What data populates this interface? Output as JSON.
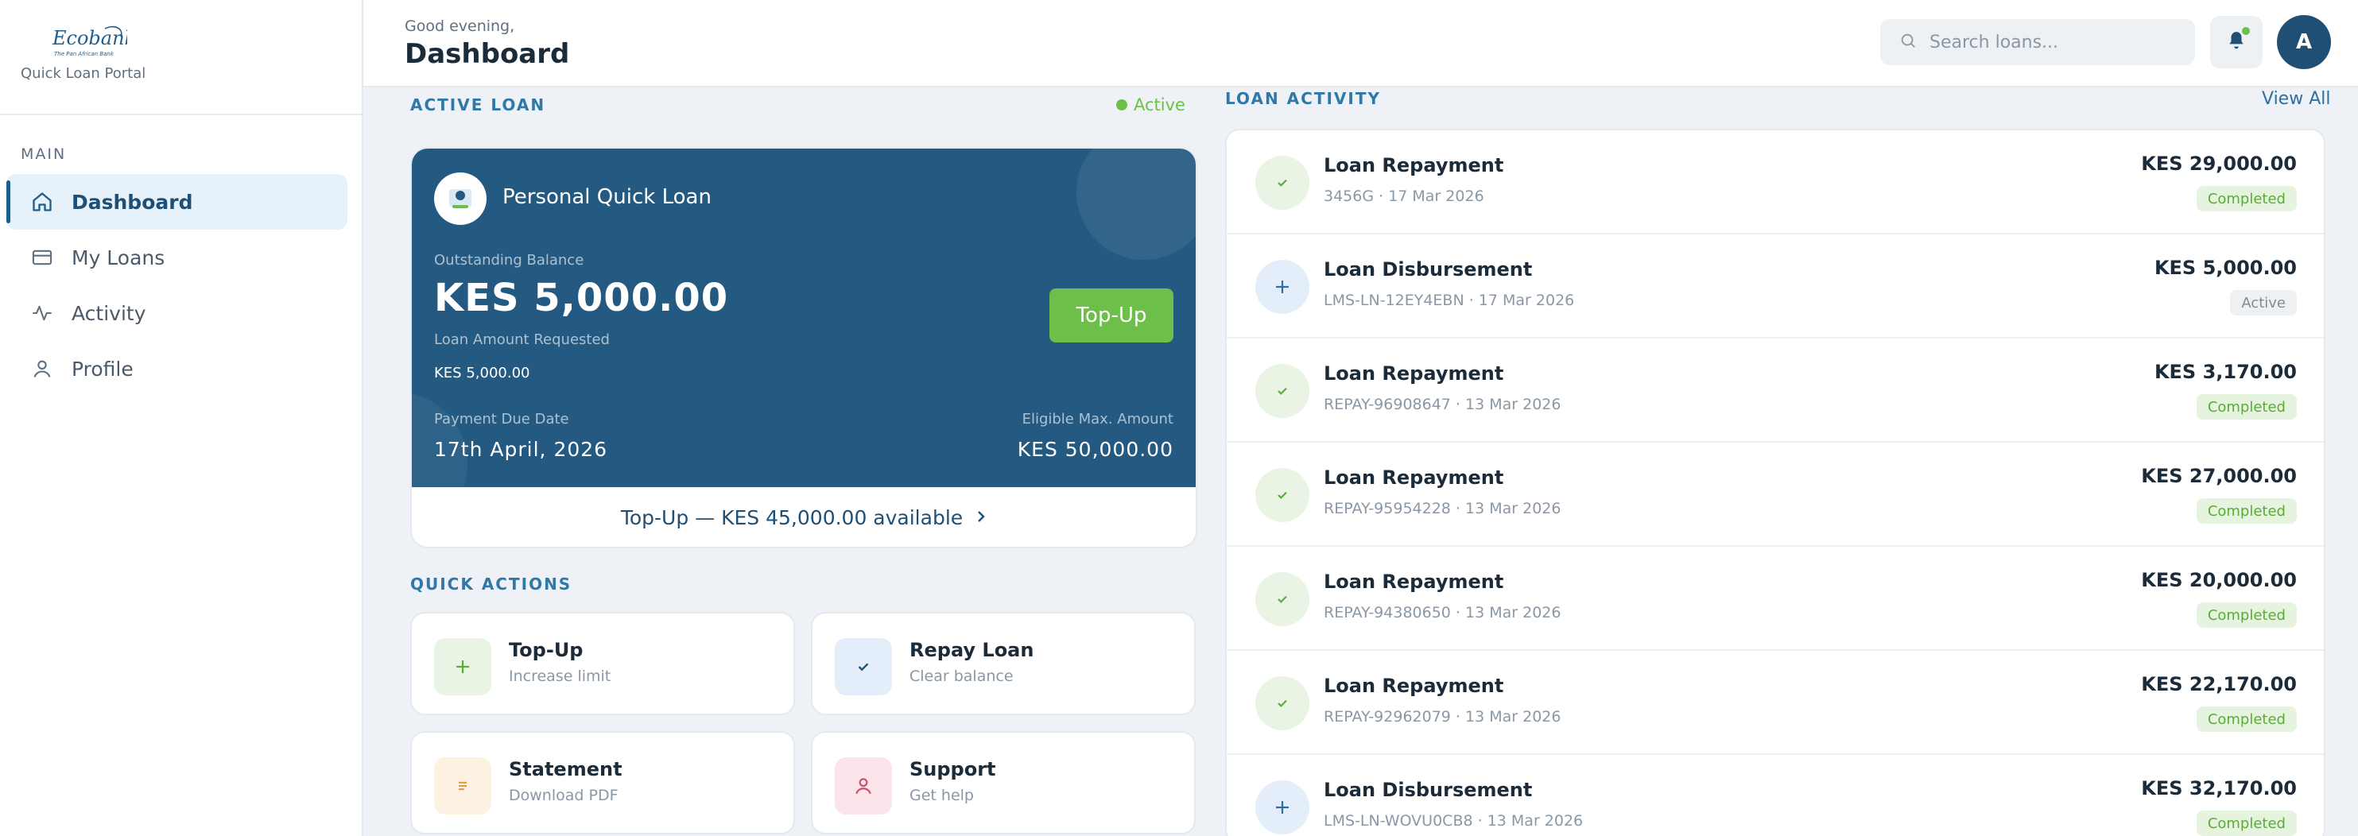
{
  "brand": {
    "logo_text": "Ecobank",
    "logo_tagline": "The Pan African Bank",
    "portal_name": "Quick Loan Portal"
  },
  "sidebar": {
    "section": "MAIN",
    "items": [
      {
        "label": "Dashboard",
        "icon": "home-icon",
        "active": true
      },
      {
        "label": "My Loans",
        "icon": "card-icon",
        "active": false
      },
      {
        "label": "Activity",
        "icon": "activity-icon",
        "active": false
      },
      {
        "label": "Profile",
        "icon": "user-icon",
        "active": false
      }
    ]
  },
  "header": {
    "greeting": "Good evening,",
    "title": "Dashboard",
    "search_placeholder": "Search loans...",
    "avatar_initial": "A"
  },
  "active_loan": {
    "section_label": "ACTIVE LOAN",
    "status": "Active",
    "name": "Personal Quick Loan",
    "outstanding_label": "Outstanding Balance",
    "outstanding_value": "KES 5,000.00",
    "requested_label": "Loan Amount Requested",
    "requested_value": "KES 5,000.00",
    "due_label": "Payment Due Date",
    "due_value": "17th April, 2026",
    "eligible_label": "Eligible Max. Amount",
    "eligible_value": "KES 50,000.00",
    "topup_button": "Top-Up",
    "topup_footer": "Top-Up — KES 45,000.00 available"
  },
  "quick_actions": {
    "section_label": "QUICK ACTIONS",
    "items": [
      {
        "title": "Top-Up",
        "subtitle": "Increase limit",
        "icon": "plus-icon"
      },
      {
        "title": "Repay Loan",
        "subtitle": "Clear balance",
        "icon": "check-icon"
      },
      {
        "title": "Statement",
        "subtitle": "Download PDF",
        "icon": "document-icon"
      },
      {
        "title": "Support",
        "subtitle": "Get help",
        "icon": "person-icon"
      }
    ]
  },
  "activity": {
    "section_label": "LOAN ACTIVITY",
    "view_all": "View All",
    "rows": [
      {
        "type": "repay",
        "title": "Loan Repayment",
        "subtitle": "3456G · 17 Mar 2026",
        "amount": "KES 29,000.00",
        "status": "Completed"
      },
      {
        "type": "disb",
        "title": "Loan Disbursement",
        "subtitle": "LMS-LN-12EY4EBN · 17 Mar 2026",
        "amount": "KES 5,000.00",
        "status": "Active"
      },
      {
        "type": "repay",
        "title": "Loan Repayment",
        "subtitle": "REPAY-96908647 · 13 Mar 2026",
        "amount": "KES 3,170.00",
        "status": "Completed"
      },
      {
        "type": "repay",
        "title": "Loan Repayment",
        "subtitle": "REPAY-95954228 · 13 Mar 2026",
        "amount": "KES 27,000.00",
        "status": "Completed"
      },
      {
        "type": "repay",
        "title": "Loan Repayment",
        "subtitle": "REPAY-94380650 · 13 Mar 2026",
        "amount": "KES 20,000.00",
        "status": "Completed"
      },
      {
        "type": "repay",
        "title": "Loan Repayment",
        "subtitle": "REPAY-92962079 · 13 Mar 2026",
        "amount": "KES 22,170.00",
        "status": "Completed"
      },
      {
        "type": "disb",
        "title": "Loan Disbursement",
        "subtitle": "LMS-LN-WOVU0CB8 · 13 Mar 2026",
        "amount": "KES 32,170.00",
        "status": "Completed"
      }
    ]
  },
  "colors": {
    "primary": "#1f4f75",
    "card": "#245a82",
    "accent_green": "#6cc04a",
    "label_blue": "#2f78a8",
    "background": "#eef2f6"
  }
}
